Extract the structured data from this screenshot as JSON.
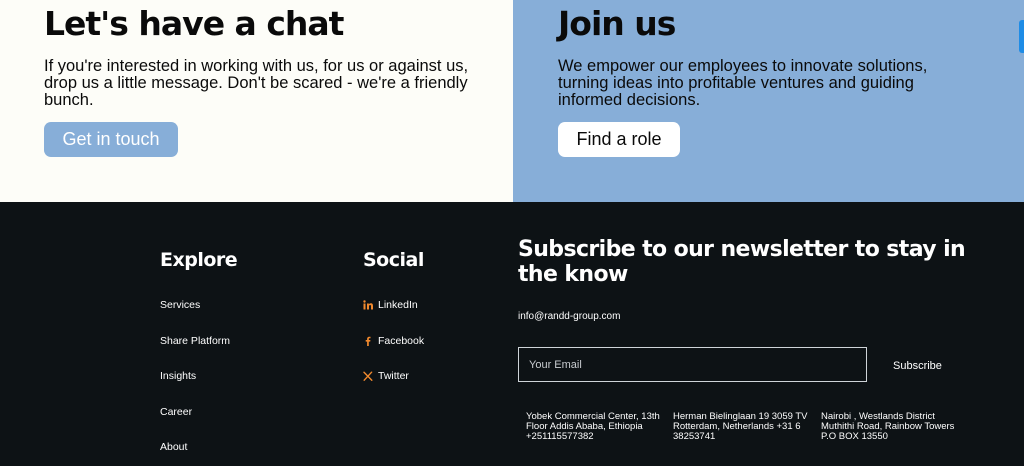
{
  "cta_left": {
    "title": "Let's have a chat",
    "text": "If you're interested in working with us, for us or against us, drop us a little message. Don't be scared - we're a friendly bunch.",
    "button": "Get in touch"
  },
  "cta_right": {
    "title": "Join us",
    "text": "We empower our employees to innovate solutions, turning ideas into profitable ventures and guiding informed decisions.",
    "button": "Find a role"
  },
  "footer": {
    "explore": {
      "heading": "Explore",
      "links": [
        "Services",
        "Share Platform",
        "Insights",
        "Career",
        "About"
      ]
    },
    "social": {
      "heading": "Social",
      "links": [
        {
          "label": "LinkedIn",
          "icon": "linkedin-icon"
        },
        {
          "label": "Facebook",
          "icon": "facebook-icon"
        },
        {
          "label": "Twitter",
          "icon": "x-twitter-icon"
        }
      ]
    },
    "newsletter": {
      "title": "Subscribe to our newsletter to stay in the know",
      "email": "info@randd-group.com",
      "placeholder": "Your Email",
      "button": "Subscribe"
    },
    "addresses": [
      "Yobek Commercial Center, 13th Floor Addis Ababa, Ethiopia +251115577382",
      "Herman Bielinglaan 19 3059 TV Rotterdam, Netherlands +31 6 38253741",
      "Nairobi , Westlands District Muthithi Road, Rainbow Towers\nP.O BOX 13550"
    ]
  },
  "colors": {
    "light_panel": "#fdfdf8",
    "accent_blue": "#87aed8",
    "footer_bg": "#0d1215",
    "icon_orange": "#f28a2e",
    "scroll_tab": "#1e8ce6"
  }
}
